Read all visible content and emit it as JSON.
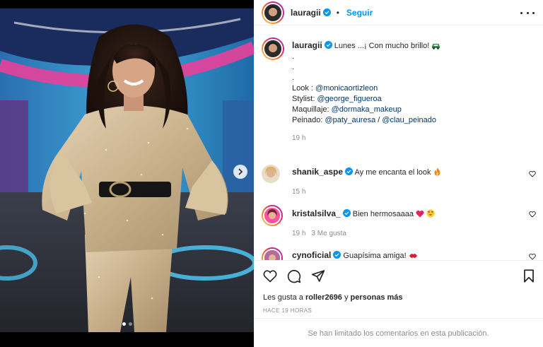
{
  "post": {
    "author": "lauragii",
    "follow_label": "Seguir",
    "separator": "•"
  },
  "caption": {
    "username": "lauragii",
    "text": "Lunes ...¡ Con mucho brillo!",
    "dots": [
      ".",
      ".",
      "."
    ],
    "credits": [
      {
        "label": "Look : ",
        "mentions": [
          "@monicaortizleon"
        ]
      },
      {
        "label": "Stylist: ",
        "mentions": [
          "@george_figueroa"
        ]
      },
      {
        "label": "Maquillaje: ",
        "mentions": [
          "@dormaka_makeup"
        ]
      },
      {
        "label": "Peinado: ",
        "mentions": [
          "@paty_auresa",
          "@clau_peinado"
        ]
      }
    ],
    "mention_sep": " / ",
    "time": "19 h"
  },
  "comments": [
    {
      "username": "shanik_aspe",
      "text": "Ay me encanta el look",
      "emoji": "fire",
      "time": "15 h",
      "likes": ""
    },
    {
      "username": "kristalsilva_",
      "text": "Bien hermosaaaa",
      "emoji": "heart-star-eyes",
      "time": "19 h",
      "likes": "3 Me gusta"
    },
    {
      "username": "cynoficial",
      "text": "Guapísima amiga!",
      "emoji": "kiss"
    }
  ],
  "footer": {
    "likes_prefix": "Les gusta a ",
    "likes_user": "roller2696",
    "likes_middle": " y ",
    "likes_suffix": "personas más",
    "timestamp": "HACE 19 HORAS",
    "limited_notice": "Se han limitado los comentarios en esta publicación."
  },
  "colors": {
    "link": "#00376b",
    "follow": "#0095f6",
    "verified": "#0095f6",
    "muted": "#8e8e8e"
  }
}
